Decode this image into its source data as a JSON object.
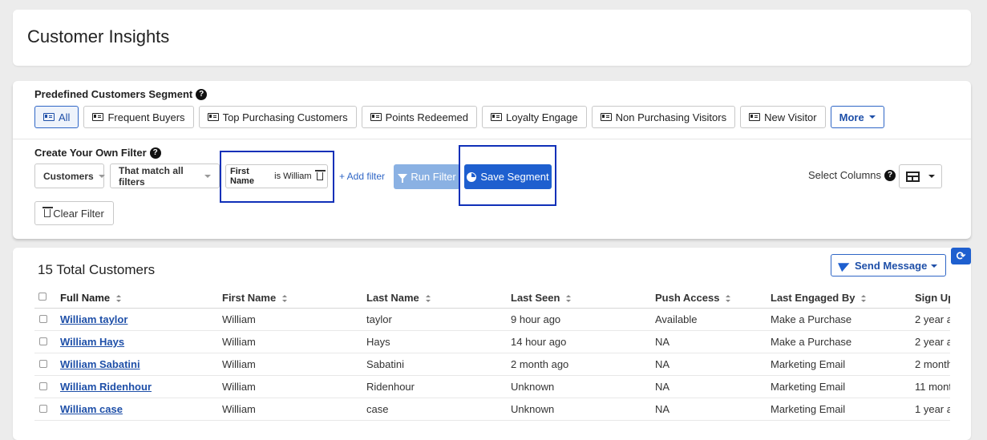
{
  "page": {
    "title": "Customer Insights"
  },
  "segments": {
    "heading": "Predefined Customers Segment",
    "items": [
      "All",
      "Frequent Buyers",
      "Top Purchasing Customers",
      "Points Redeemed",
      "Loyalty Engage",
      "Non Purchasing Visitors",
      "New Visitor"
    ],
    "active": "All",
    "more_label": "More"
  },
  "filter": {
    "heading": "Create Your Own Filter",
    "entity_select": "Customers",
    "match_select": "That match all filters",
    "chip": {
      "field": "First Name",
      "operator": "is",
      "value": "William"
    },
    "add_filter_label": "+ Add filter",
    "run_filter_label": "Run Filter",
    "save_segment_label": "Save Segment",
    "clear_filter_label": "Clear Filter",
    "select_columns_label": "Select Columns"
  },
  "results": {
    "total_label": "15 Total Customers",
    "send_message_label": "Send Message",
    "columns": [
      "Full Name",
      "First Name",
      "Last Name",
      "Last Seen",
      "Push Access",
      "Last Engaged By",
      "Sign Up"
    ],
    "rows": [
      [
        "William taylor",
        "William",
        "taylor",
        "9 hour ago",
        "Available",
        "Make a Purchase",
        "2 year a"
      ],
      [
        "William Hays",
        "William",
        "Hays",
        "14 hour ago",
        "NA",
        "Make a Purchase",
        "2 year a"
      ],
      [
        "William Sabatini",
        "William",
        "Sabatini",
        "2 month ago",
        "NA",
        "Marketing Email",
        "2 month"
      ],
      [
        "William Ridenhour",
        "William",
        "Ridenhour",
        "Unknown",
        "NA",
        "Marketing Email",
        "11 mont"
      ],
      [
        "William case",
        "William",
        "case",
        "Unknown",
        "NA",
        "Marketing Email",
        "1 year a"
      ]
    ]
  },
  "colors": {
    "accent": "#1e5fcf",
    "highlight_border": "#1030b8",
    "link": "#1e4fa8",
    "background": "#ececec"
  }
}
